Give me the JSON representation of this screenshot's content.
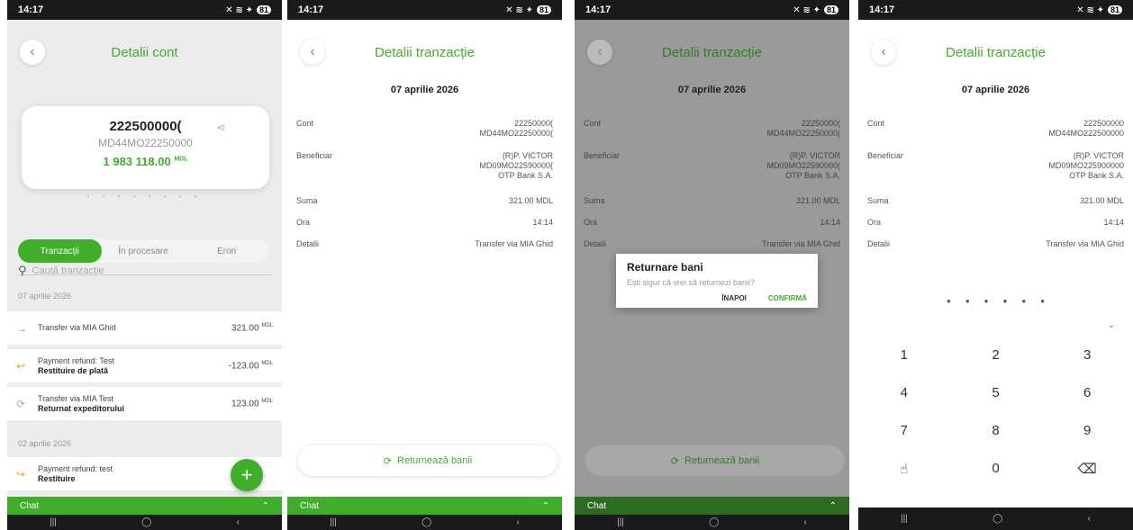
{
  "status_time": "14:17",
  "battery": "81",
  "screen1": {
    "title": "Detalii cont",
    "account_number": "222500000(",
    "iban": "MD44MO22250000",
    "balance": "1 983 118.00",
    "currency": "MDL",
    "tabs": [
      "Tranzacții",
      "În procesare",
      "Erori"
    ],
    "search_placeholder": "Caută tranzacție",
    "date1": "07 aprilie 2026",
    "date2": "02 aprilie 2026",
    "tx": [
      {
        "line1": "Transfer via MIA Ghid",
        "line2": "",
        "amount": "321.00"
      },
      {
        "line1": "Payment refund: Test",
        "line2": "Restituire de plată",
        "amount": "-123.00"
      },
      {
        "line1": "Transfer via MIA Test",
        "line2": "Returnat expeditorului",
        "amount": "123.00"
      },
      {
        "line1": "Payment refund: test",
        "line2": "Restituire",
        "amount": ""
      }
    ],
    "chat": "Chat"
  },
  "details": {
    "title": "Detalii tranzacție",
    "date": "07 aprilie 2026",
    "cont_label": "Cont",
    "cont_v1": "22250000(",
    "cont_v2": "MD44MO22250000(",
    "ben_label": "Beneficiar",
    "ben_v1": "(R)P. VICTOR",
    "ben_v2": "MD09MO22590000(",
    "ben_v3": "OTP Bank S.A.",
    "suma_label": "Suma",
    "suma_v": "321.00 MDL",
    "ora_label": "Ora",
    "ora_v": "14:14",
    "det_label": "Detalii",
    "det_v": "Transfer via MIA Ghid",
    "return_btn": "Returnează banii",
    "chat": "Chat"
  },
  "dialog": {
    "title": "Returnare bani",
    "question": "Ești sigur că vrei să returnezi banii?",
    "back": "ÎNAPOI",
    "confirm": "CONFIRMĂ"
  },
  "screen4": {
    "cont_v1": "222500000",
    "cont_v2": "MD44MO222500000",
    "ben_v1": "(R)P. VICTOR",
    "ben_v2": "MD09MO225900000",
    "ben_v3": "OTP Bank S.A.",
    "keys": [
      "1",
      "2",
      "3",
      "4",
      "5",
      "6",
      "7",
      "8",
      "9",
      "0"
    ]
  },
  "colors": {
    "accent": "#3fae2a"
  }
}
